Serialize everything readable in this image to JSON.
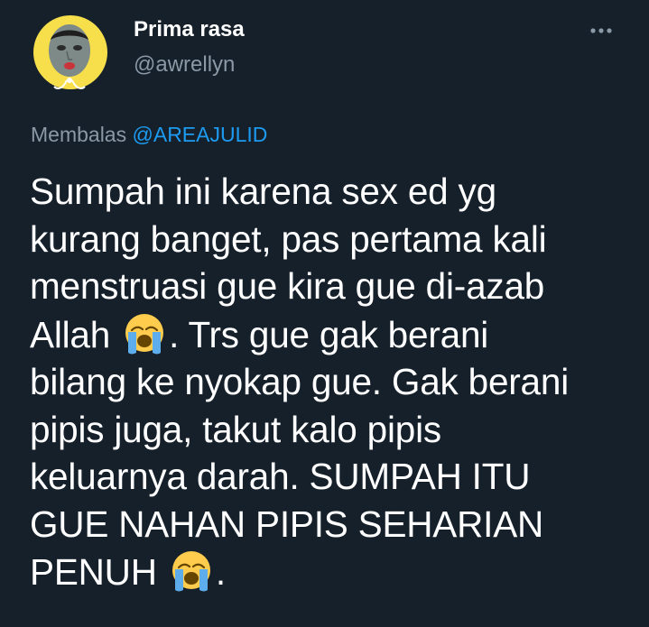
{
  "author": {
    "display_name": "Prima rasa",
    "handle": "@awrellyn"
  },
  "reply": {
    "prefix": "Membalas",
    "mention": "@AREAJULID"
  },
  "tweet": {
    "lines": [
      {
        "text": "Sumpah ini karena sex ed yg"
      },
      {
        "text": "kurang banget, pas pertama kali"
      },
      {
        "text": "menstruasi gue kira gue di-azab"
      },
      {
        "before": "Allah ",
        "emoji": "loudly-crying-face",
        "after": ". Trs gue gak berani"
      },
      {
        "text": "bilang ke nyokap gue. Gak berani"
      },
      {
        "text": "pipis juga, takut kalo pipis"
      },
      {
        "text": "keluarnya darah. SUMPAH ITU"
      },
      {
        "text": "GUE NAHAN PIPIS SEHARIAN"
      },
      {
        "before": "PENUH ",
        "emoji": "loudly-crying-face",
        "after": "."
      }
    ]
  },
  "icons": {
    "more": "more-horizontal-icon",
    "emoji": "loudly-crying-face"
  },
  "colors": {
    "background": "#15202b",
    "text_primary": "#ffffff",
    "text_secondary": "#8b98a5",
    "link": "#1d9bf0",
    "avatar_frame": "#f7df4b"
  }
}
